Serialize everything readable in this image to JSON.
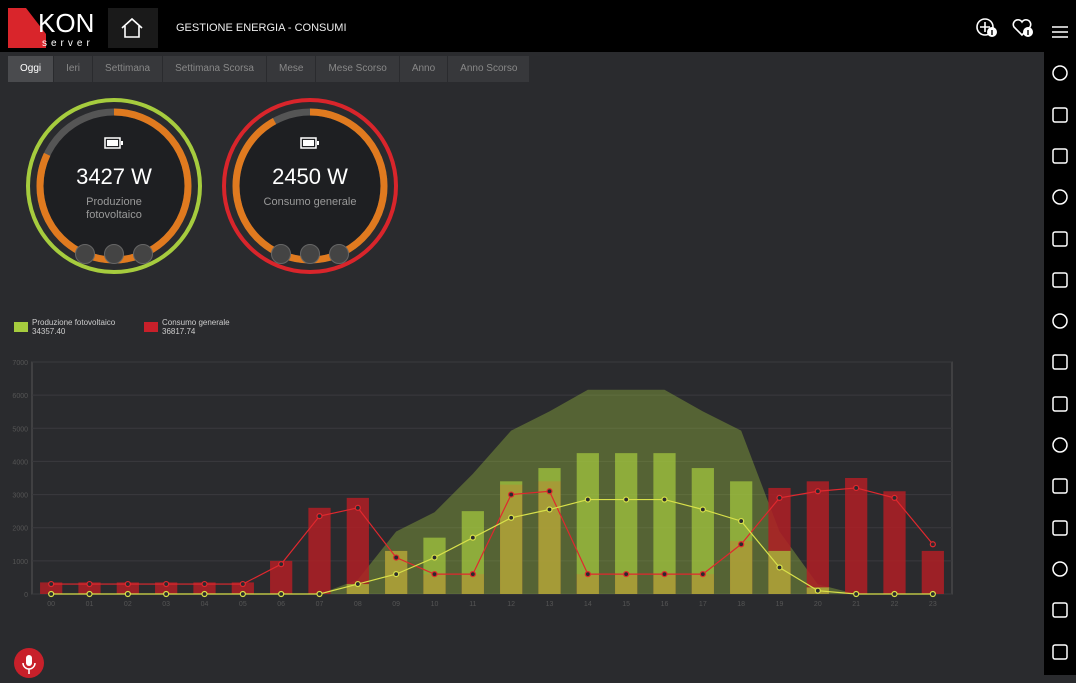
{
  "header": {
    "logo_main": "KON",
    "logo_sub": "server",
    "breadcrumb": "GESTIONE ENERGIA - CONSUMI"
  },
  "tabs": [
    {
      "label": "Oggi",
      "active": true
    },
    {
      "label": "Ieri"
    },
    {
      "label": "Settimana"
    },
    {
      "label": "Settimana Scorsa"
    },
    {
      "label": "Mese"
    },
    {
      "label": "Mese Scorso"
    },
    {
      "label": "Anno"
    },
    {
      "label": "Anno Scorso"
    }
  ],
  "gauges": [
    {
      "value": "3427 W",
      "label": "Produzione fotovoltaico",
      "ring_color": "#a6cc3e",
      "fraction": 0.82
    },
    {
      "value": "2450 W",
      "label": "Consumo generale",
      "ring_color": "#d9252b",
      "fraction": 0.92
    }
  ],
  "legend": [
    {
      "name": "Produzione fotovoltaico",
      "value": "34357.40",
      "color": "#a6cc3e"
    },
    {
      "name": "Consumo generale",
      "value": "36817.74",
      "color": "#c8202a"
    }
  ],
  "colors": {
    "green": "#a6cc3e",
    "red": "#c8202a",
    "orange": "#e07a1f",
    "accent": "#d9252b"
  },
  "chart_data": {
    "type": "bar",
    "categories": [
      "00",
      "01",
      "02",
      "03",
      "04",
      "05",
      "06",
      "07",
      "08",
      "09",
      "10",
      "11",
      "12",
      "13",
      "14",
      "15",
      "16",
      "17",
      "18",
      "19",
      "20",
      "21",
      "22",
      "23"
    ],
    "ylim": [
      0,
      7000
    ],
    "yticks": [
      "0",
      "1000",
      "2000",
      "3000",
      "4000",
      "5000",
      "6000",
      "7000"
    ],
    "series": [
      {
        "name": "Produzione fotovoltaico",
        "values": [
          0,
          0,
          0,
          0,
          0,
          0,
          0,
          0,
          300,
          1300,
          1700,
          2500,
          3400,
          3800,
          4250,
          4250,
          4250,
          3800,
          3400,
          1300,
          200,
          0,
          0,
          0
        ]
      },
      {
        "name": "Consumo generale",
        "values": [
          350,
          350,
          350,
          350,
          350,
          350,
          1000,
          2600,
          2900,
          1300,
          600,
          600,
          3300,
          3400,
          600,
          600,
          600,
          600,
          1600,
          3200,
          3400,
          3500,
          3100,
          1300
        ]
      }
    ],
    "line_production": [
      0,
      0,
      0,
      0,
      0,
      0,
      0,
      0,
      300,
      600,
      1100,
      1700,
      2300,
      2550,
      2850,
      2850,
      2850,
      2550,
      2200,
      800,
      100,
      0,
      0,
      0
    ],
    "line_consumption": [
      300,
      300,
      300,
      300,
      300,
      300,
      900,
      2350,
      2600,
      1100,
      600,
      600,
      3000,
      3100,
      600,
      600,
      600,
      600,
      1500,
      2900,
      3100,
      3200,
      2900,
      1500
    ]
  }
}
